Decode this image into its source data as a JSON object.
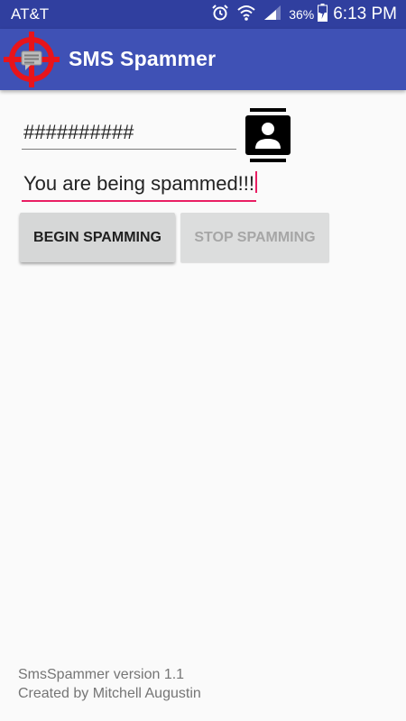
{
  "status_bar": {
    "carrier": "AT&T",
    "battery_percent": "36%",
    "time": "6:13 PM",
    "icons": [
      "alarm-icon",
      "wifi-icon",
      "signal-icon",
      "battery-charging-icon"
    ]
  },
  "app_bar": {
    "title": "SMS Spammer",
    "logo_icon": "crosshair-message-logo",
    "color": "#3f51b5",
    "status_color": "#303f9f"
  },
  "form": {
    "phone_value": "##########",
    "contacts_icon": "contact-book-icon",
    "message_value": "You are being spammed!!!",
    "accent_color": "#e91e63"
  },
  "buttons": {
    "begin_label": "BEGIN SPAMMING",
    "stop_label": "STOP SPAMMING",
    "stop_enabled": false
  },
  "footer": {
    "version": "SmsSpammer version 1.1",
    "credit": "Created by Mitchell Augustin"
  }
}
